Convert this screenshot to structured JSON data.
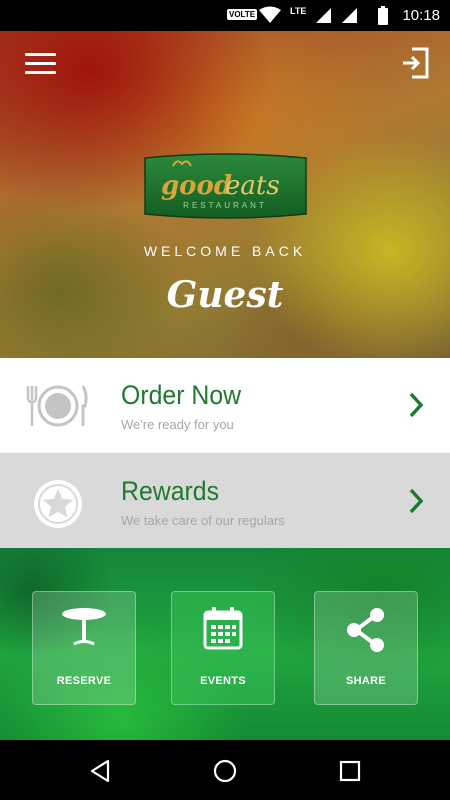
{
  "status_bar": {
    "volte_label": "VOLTE",
    "network_label": "LTE",
    "time": "10:18"
  },
  "hero": {
    "logo_text_good": "good",
    "logo_text_eats": "eats",
    "logo_subtitle": "RESTAURANT",
    "welcome": "WELCOME BACK",
    "user_name": "Guest"
  },
  "actions": {
    "order": {
      "title": "Order Now",
      "subtitle": "We're ready for you"
    },
    "rewards": {
      "title": "Rewards",
      "subtitle": "We take care of our regulars"
    }
  },
  "tiles": {
    "reserve": "RESERVE",
    "events": "EVENTS",
    "share": "SHARE"
  },
  "colors": {
    "brand_green": "#1f7a30",
    "logo_gold": "#d7a53a"
  },
  "icons": [
    "menu-icon",
    "login-icon",
    "plate-icon",
    "star-icon",
    "chevron-right-icon",
    "table-icon",
    "calendar-icon",
    "share-icon",
    "back-icon",
    "home-icon",
    "recents-icon"
  ]
}
